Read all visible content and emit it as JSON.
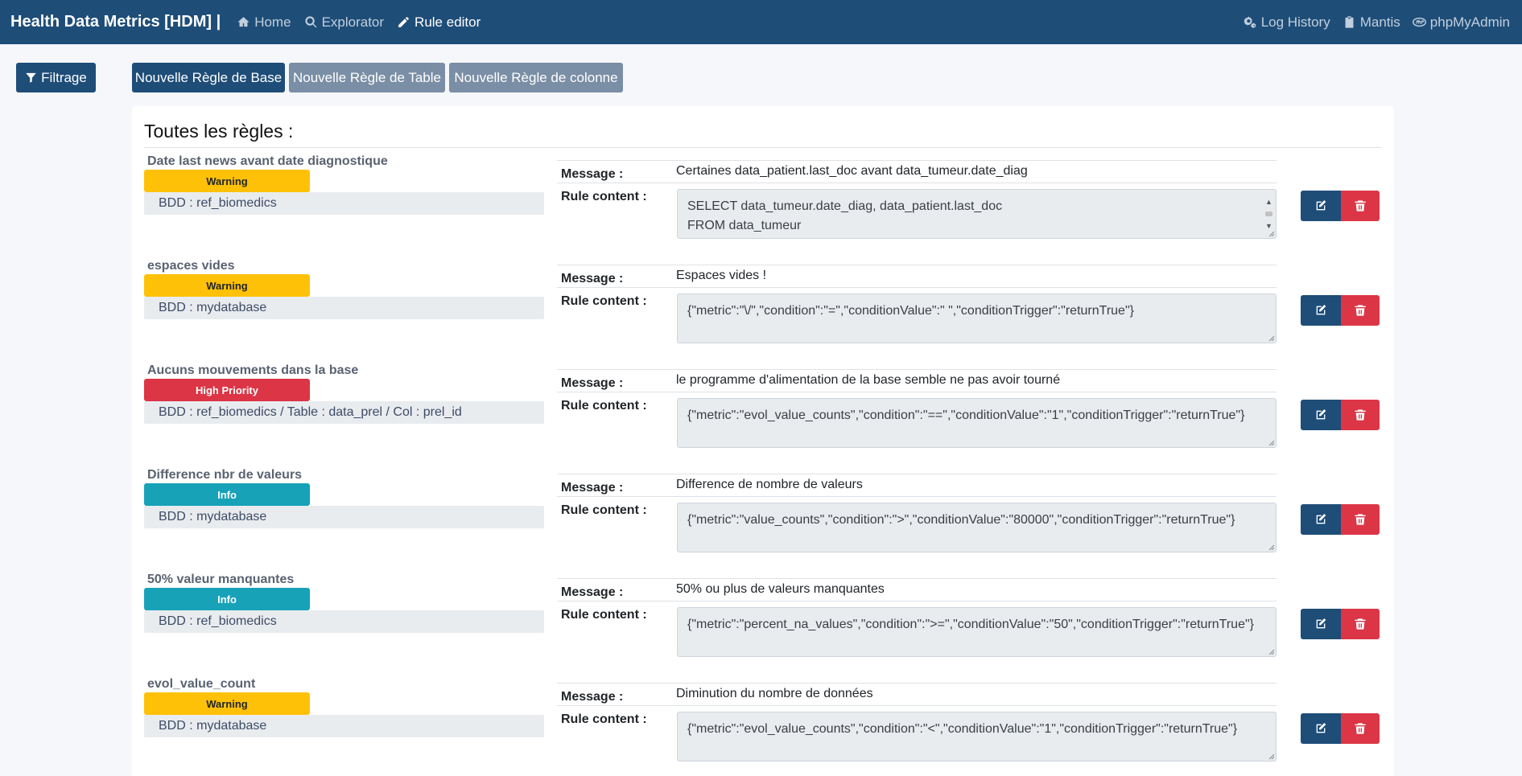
{
  "nav": {
    "brand": "Health Data Metrics [HDM] |",
    "links": [
      {
        "label": "Home",
        "icon": "home-icon"
      },
      {
        "label": "Explorator",
        "icon": "search-icon"
      },
      {
        "label": "Rule editor",
        "icon": "pencil-icon"
      }
    ],
    "right_links": [
      {
        "label": "Log History",
        "icon": "cogs-icon"
      },
      {
        "label": "Mantis",
        "icon": "clipboard-icon"
      },
      {
        "label": "phpMyAdmin",
        "icon": "php-icon"
      }
    ]
  },
  "toolbar": {
    "filter_label": "Filtrage",
    "new_base_rule": "Nouvelle Règle de Base",
    "new_table_rule": "Nouvelle Règle de Table",
    "new_column_rule": "Nouvelle Règle de colonne"
  },
  "card": {
    "title": "Toutes les règles :"
  },
  "labels": {
    "message": "Message :",
    "rule_content": "Rule content :"
  },
  "colors": {
    "primary": "#1e4d78",
    "secondary": "#7a8ea5",
    "warning": "#ffc107",
    "danger": "#dc3545",
    "info": "#17a2b8"
  },
  "rules": [
    {
      "name": "Date last news avant date diagnostique",
      "priority": "Warning",
      "priority_style": "warning",
      "scope": "BDD : ref_biomedics",
      "message": "Certaines data_patient.last_doc avant data_tumeur.date_diag",
      "content": "SELECT data_tumeur.date_diag, data_patient.last_doc\nFROM data_tumeur",
      "scrollable": true
    },
    {
      "name": "espaces vides",
      "priority": "Warning",
      "priority_style": "warning",
      "scope": "BDD : mydatabase",
      "message": "Espaces vides !",
      "content": "{\"metric\":\"\\/\",\"condition\":\"=\",\"conditionValue\":\" \",\"conditionTrigger\":\"returnTrue\"}",
      "scrollable": false
    },
    {
      "name": "Aucuns mouvements dans la base",
      "priority": "High Priority",
      "priority_style": "danger",
      "scope": "BDD : ref_biomedics  /  Table : data_prel  /  Col : prel_id",
      "message": "le programme d'alimentation de la base semble ne pas avoir tourné",
      "content": "{\"metric\":\"evol_value_counts\",\"condition\":\"==\",\"conditionValue\":\"1\",\"conditionTrigger\":\"returnTrue\"}",
      "scrollable": false
    },
    {
      "name": "Difference nbr de valeurs",
      "priority": "Info",
      "priority_style": "info",
      "scope": "BDD : mydatabase",
      "message": "Difference de nombre de valeurs",
      "content": "{\"metric\":\"value_counts\",\"condition\":\">\",\"conditionValue\":\"80000\",\"conditionTrigger\":\"returnTrue\"}",
      "scrollable": false
    },
    {
      "name": "50% valeur manquantes",
      "priority": "Info",
      "priority_style": "info",
      "scope": "BDD : ref_biomedics",
      "message": "50% ou plus de valeurs manquantes",
      "content": "{\"metric\":\"percent_na_values\",\"condition\":\">=\",\"conditionValue\":\"50\",\"conditionTrigger\":\"returnTrue\"}",
      "scrollable": false
    },
    {
      "name": "evol_value_count",
      "priority": "Warning",
      "priority_style": "warning",
      "scope": "BDD : mydatabase",
      "message": "Diminution du nombre de données",
      "content": "{\"metric\":\"evol_value_counts\",\"condition\":\"<\",\"conditionValue\":\"1\",\"conditionTrigger\":\"returnTrue\"}",
      "scrollable": false
    }
  ]
}
